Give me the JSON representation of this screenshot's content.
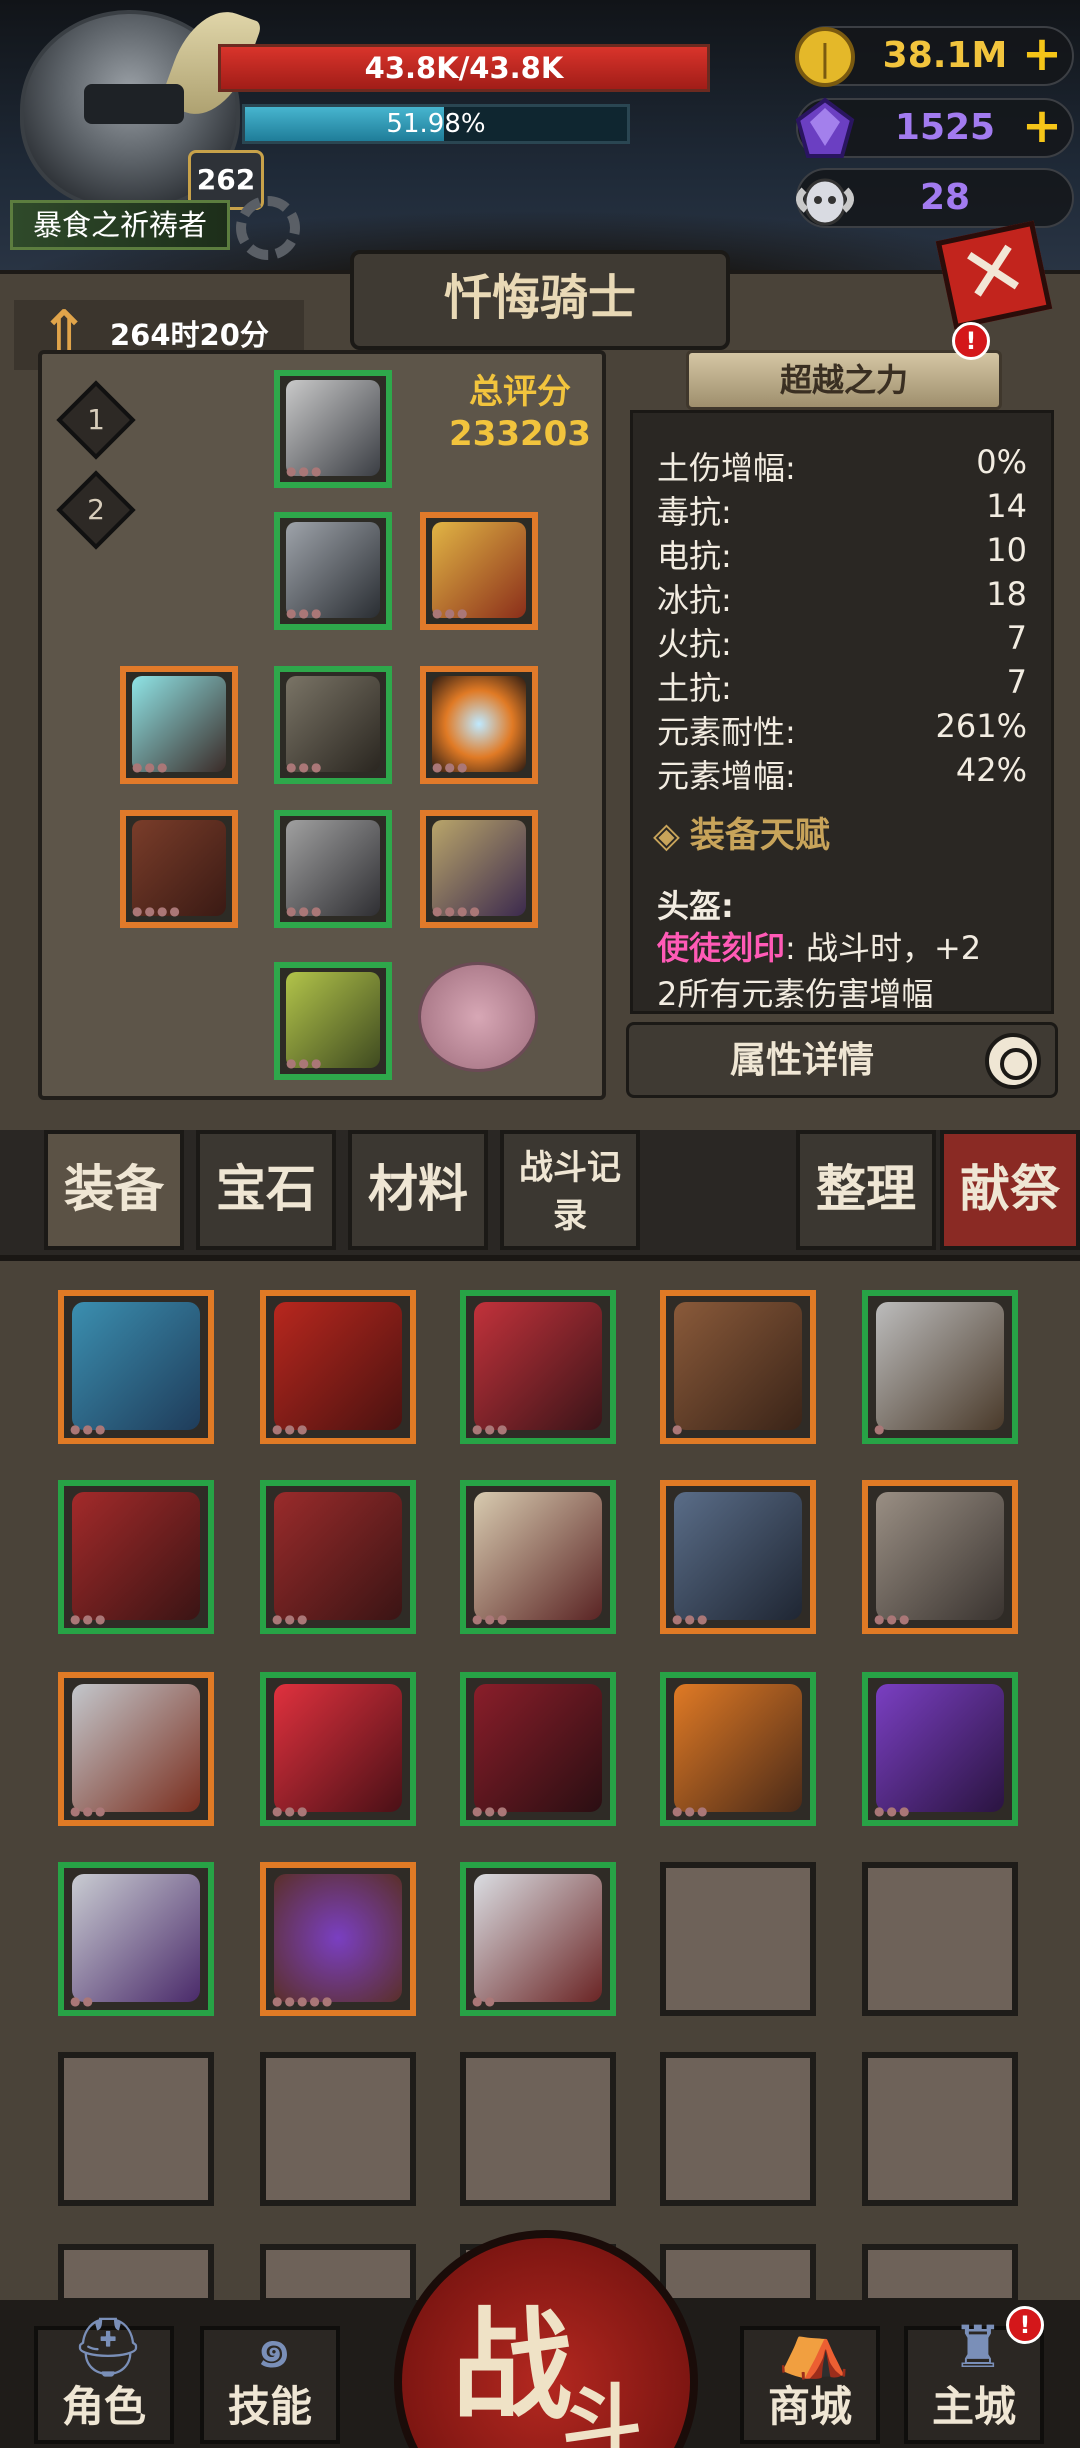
{
  "player": {
    "level": "262",
    "title": "暴食之祈祷者",
    "hp_text": "43.8K/43.8K",
    "hp_fraction": 1.0,
    "xp_text": "51.98%",
    "xp_fraction": 0.5198
  },
  "resources": {
    "gold": "38.1M",
    "crystal": "1525",
    "ram": "28",
    "plus": "+"
  },
  "close_label": "✕",
  "character": {
    "name": "忏悔骑士",
    "timer": "264时20分",
    "slot_1": "1",
    "slot_2": "2",
    "total_score_label": "总评分",
    "total_score": "233203"
  },
  "stats": {
    "transcend_label": "超越之力",
    "alert": "!",
    "rows": [
      {
        "label": "土伤增幅:",
        "value": "0%"
      },
      {
        "label": "毒抗:",
        "value": "14"
      },
      {
        "label": "电抗:",
        "value": "10"
      },
      {
        "label": "冰抗:",
        "value": "18"
      },
      {
        "label": "火抗:",
        "value": "7"
      },
      {
        "label": "土抗:",
        "value": "7"
      },
      {
        "label": "元素耐性:",
        "value": "261%"
      },
      {
        "label": "元素增幅:",
        "value": "42%"
      }
    ],
    "talent_header": "装备天赋",
    "helm_label": "头盔:",
    "talent_name": "使徒刻印",
    "talent_text": ": 战斗时，+2",
    "talent_text2": "2所有元素伤害增幅",
    "detail_label": "属性详情"
  },
  "tabs": {
    "equipment": "装备",
    "gem": "宝石",
    "material": "材料",
    "battle_log": "战斗记录",
    "sort": "整理",
    "offering": "献祭"
  },
  "nav": {
    "character": "角色",
    "skill": "技能",
    "battle_1": "战",
    "battle_2": "斗",
    "shop": "商城",
    "main_city": "主城",
    "alert": "!"
  }
}
